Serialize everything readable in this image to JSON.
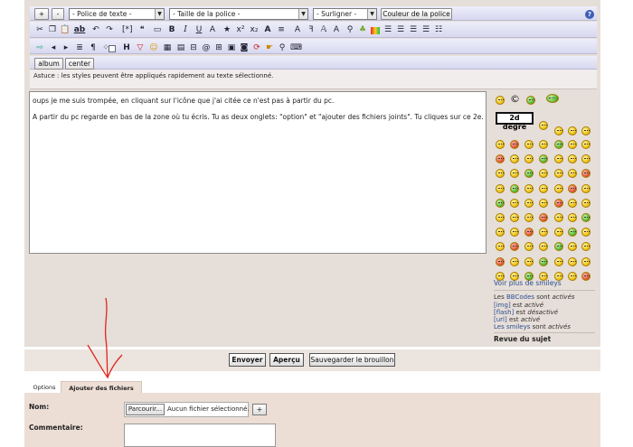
{
  "toolbar": {
    "plus_label": "+",
    "minus_label": "-",
    "font_select": "- Police de texte -",
    "size_select": "- Taille de la police -",
    "highlight_select": "- Surligner -",
    "font_color_label": "Couleur de la police",
    "help_label": "?",
    "format_icons": [
      "cut",
      "copy",
      "paste",
      "spellcheck",
      "undo",
      "redo",
      "code",
      "quote",
      "bold",
      "italic",
      "underline",
      "strike",
      "superscript",
      "subscript",
      "font",
      "text-effect",
      "link",
      "image",
      "colors",
      "align-left",
      "align-center",
      "align-right",
      "justify",
      "list"
    ],
    "row3_icons": [
      "insert",
      "arrow-left",
      "arrow-right",
      "list",
      "color",
      "box",
      "heading",
      "warning",
      "smiley",
      "table",
      "grid",
      "separator",
      "email",
      "media",
      "flash",
      "video",
      "quote-block",
      "search",
      "code"
    ],
    "album_label": "album",
    "center_label": "center"
  },
  "astuce": "Astuce : les styles peuvent être appliqués rapidement au texte sélectionné.",
  "message": {
    "line1": "oups je me suis trompée, en cliquant sur l'icône que j'ai citée ce n'est pas à partir du pc.",
    "line2": "A partir du pc regarde en bas de la zone où tu écris.  Tu as deux onglets: \"option\" et \"ajouter des fichiers joints\". Tu cliques sur ce 2e."
  },
  "smileys": {
    "degre_label": "2d degré",
    "copyright": "©",
    "more_link": "Voir plus de smileys"
  },
  "status": {
    "bbcodes_prefix": "Les ",
    "bbcodes_link": "BBCodes",
    "bbcodes_state": " sont ",
    "bbcodes_value": "activés",
    "img_link": "[img]",
    "img_state": " est ",
    "img_value": "activé",
    "flash_link": "[flash]",
    "flash_state": " est ",
    "flash_value": "désactivé",
    "url_link": "[url]",
    "url_state": " est ",
    "url_value": "activé",
    "smileys_prefix": "Les smileys",
    "smileys_state": " sont ",
    "smileys_value": "activés"
  },
  "revue": "Revue du sujet",
  "buttons": {
    "send": "Envoyer",
    "preview": "Aperçu",
    "save_draft": "Sauvegarder le brouillon"
  },
  "tabs": {
    "options": "Options",
    "attachments": "Ajouter des fichiers joints"
  },
  "attach": {
    "name_label": "Nom:",
    "browse_label": "Parcourir...",
    "no_file": "Aucun fichier sélectionné.",
    "plus_label": "+",
    "comment_label": "Commentaire:"
  }
}
